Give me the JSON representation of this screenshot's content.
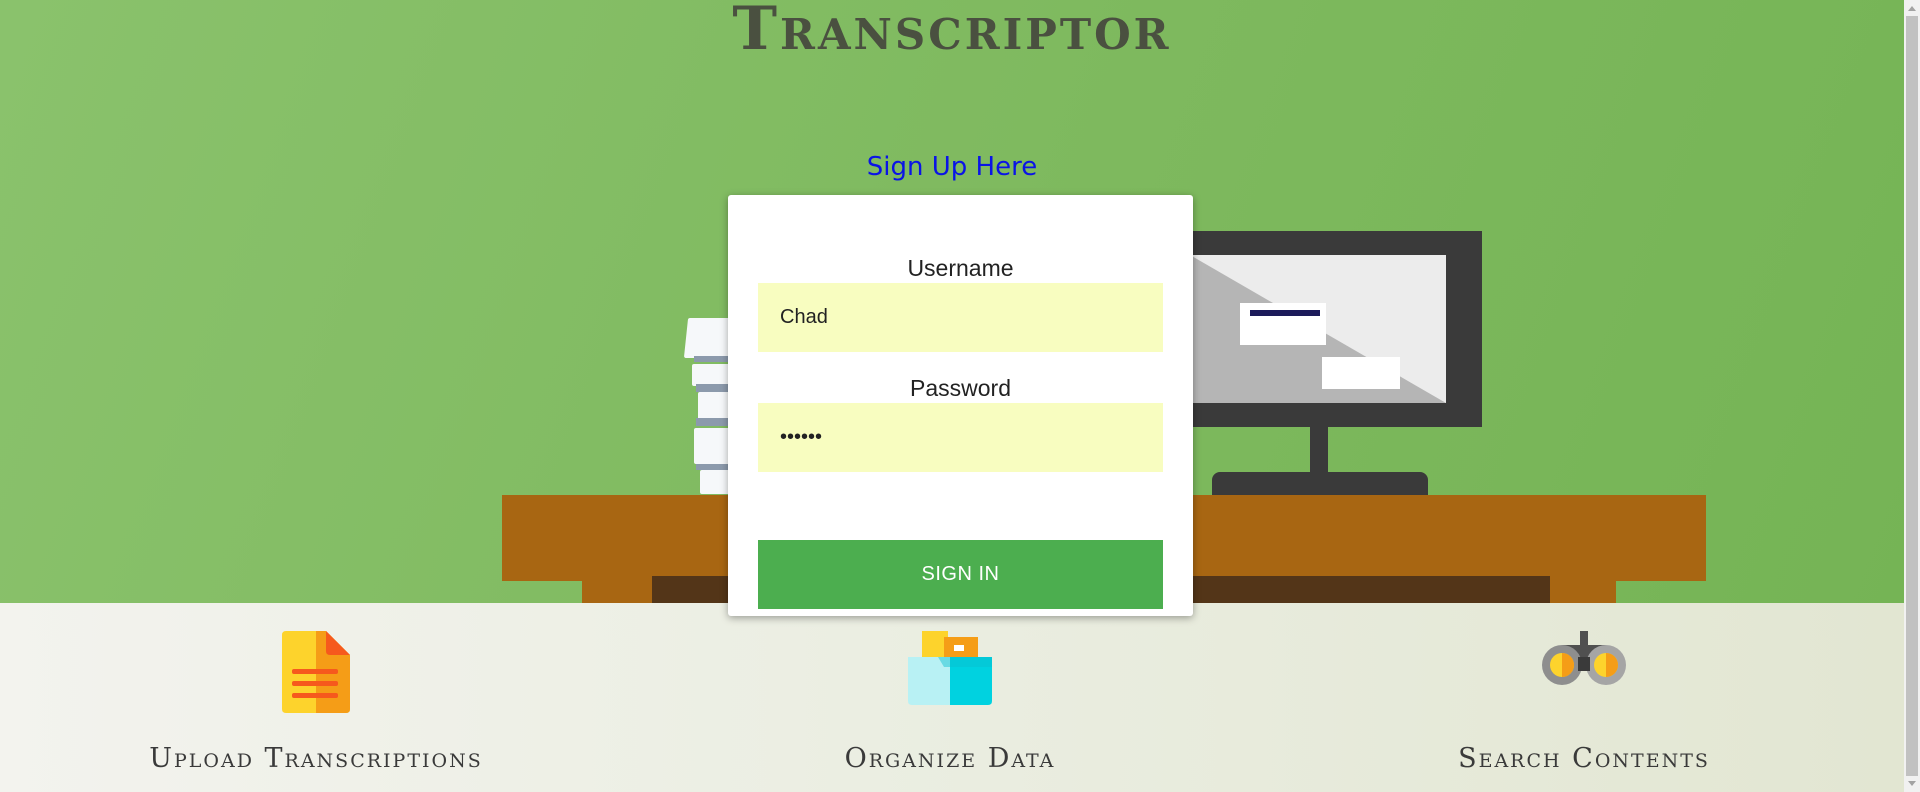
{
  "header": {
    "title": "Transcriptor",
    "signup_link": "Sign Up Here"
  },
  "login": {
    "username_label": "Username",
    "username_value": "Chad",
    "password_label": "Password",
    "password_value": "••••••",
    "signin_label": "SIGN IN"
  },
  "features": [
    {
      "title": "Upload Transcriptions",
      "icon": "document-icon"
    },
    {
      "title": "Organize Data",
      "icon": "folder-box-icon"
    },
    {
      "title": "Search Contents",
      "icon": "binoculars-icon"
    }
  ],
  "colors": {
    "hero_background": "#7eb95e",
    "title_text": "#4a5040",
    "signup_link": "#0a14e6",
    "input_background": "#f8fdc0",
    "signin_button": "#4cae4f",
    "desk": "#a86612",
    "monitor": "#3a3a3a"
  }
}
